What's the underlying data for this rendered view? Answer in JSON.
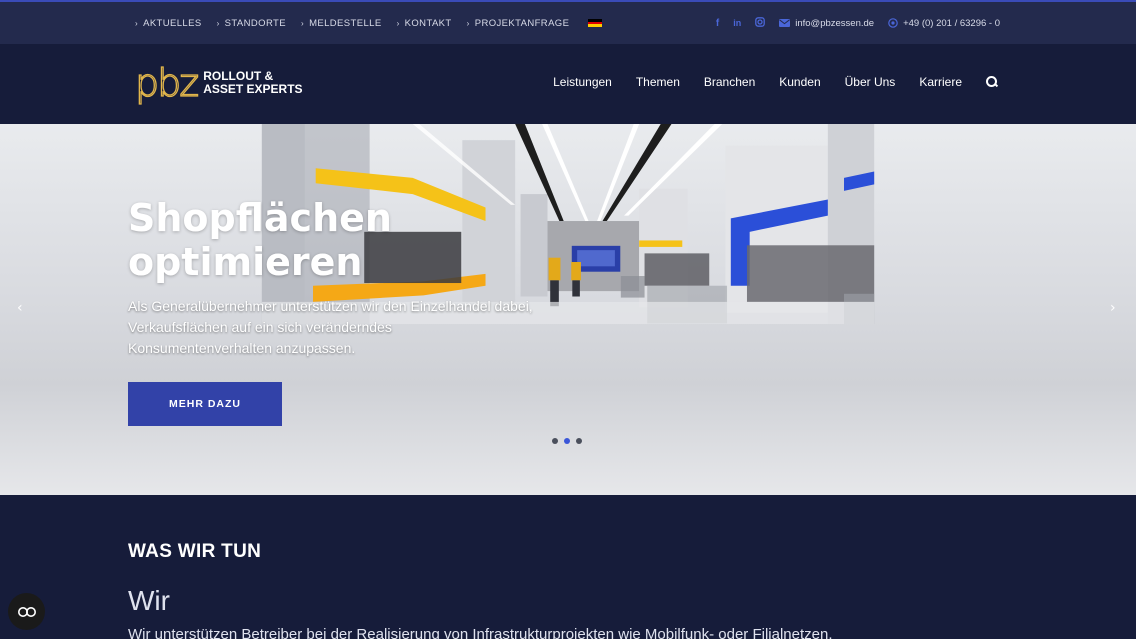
{
  "topbar": {
    "nav": [
      {
        "label": "AKTUELLES"
      },
      {
        "label": "STANDORTE"
      },
      {
        "label": "MELDESTELLE"
      },
      {
        "label": "KONTAKT"
      },
      {
        "label": "PROJEKTANFRAGE"
      }
    ],
    "social_icons": [
      "facebook-icon",
      "linkedin-icon",
      "instagram-icon"
    ],
    "email": "info@pbzessen.de",
    "phone": "+49 (0) 201 / 63296 - 0",
    "flag_colors": [
      "#000000",
      "#dd0000",
      "#ffce00"
    ]
  },
  "header": {
    "logo_mark": "pbz",
    "logo_line1": "ROLLOUT &",
    "logo_line2": "ASSET EXPERTS",
    "nav": [
      {
        "label": "Leistungen"
      },
      {
        "label": "Themen"
      },
      {
        "label": "Branchen"
      },
      {
        "label": "Kunden"
      },
      {
        "label": "Über Uns"
      },
      {
        "label": "Karriere"
      }
    ]
  },
  "hero": {
    "title_line1": "Shopflächen",
    "title_line2": "optimieren",
    "text": "Als Generalübernehmer unterstützen wir den Einzelhandel dabei, Verkaufsflächen auf ein sich veränderndes Konsumentenverhalten anzupassen.",
    "button": "MEHR DAZU",
    "slides_total": 3,
    "slide_active": 2
  },
  "section": {
    "title": "WAS WIR TUN",
    "subtitle": "Wir",
    "text": "Wir unterstützen Betreiber bei der Realisierung von Infrastrukturprojekten wie Mobilfunk- oder Filialnetzen."
  },
  "colors": {
    "accent": "#3242a8",
    "dark_bg": "#161c3a",
    "topbar_bg": "#232a4d",
    "logo_gold": "#e2b64b"
  }
}
